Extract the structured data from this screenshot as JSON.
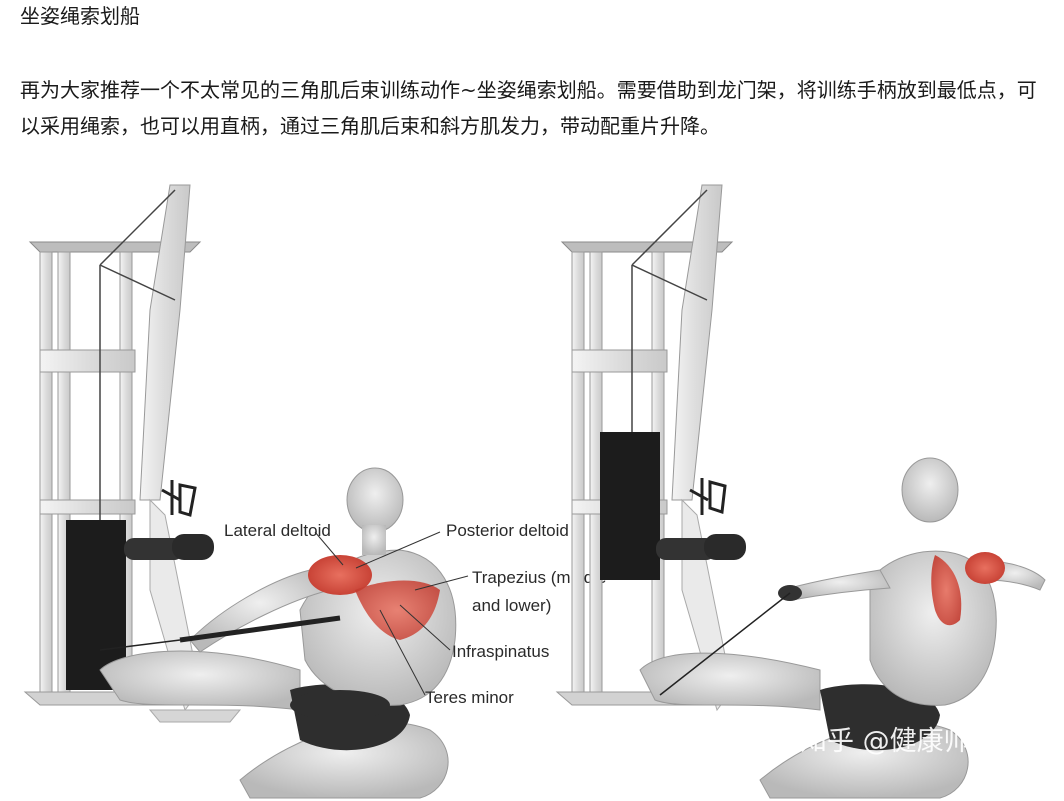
{
  "article": {
    "heading": "坐姿绳索划船",
    "paragraph": "再为大家推荐一个不太常见的三角肌后束训练动作~坐姿绳索划船。需要借助到龙门架，将训练手柄放到最低点，可以采用绳索，也可以用直柄，通过三角肌后束和斜方肌发力，带动配重片升降。"
  },
  "figure": {
    "labels": {
      "lateral_deltoid": "Lateral deltoid",
      "posterior_deltoid": "Posterior deltoid",
      "trapezius_1": "Trapezius (middle",
      "trapezius_2": "and lower)",
      "infraspinatus": "Infraspinatus",
      "teres_minor": "Teres minor"
    },
    "watermark": "知乎 @健康帅帅",
    "colors": {
      "machine_frame": "#e6e6e6",
      "weight_stack": "#1c1c1c",
      "muscle_highlight": "#d9534f",
      "skin": "#d8d8d8",
      "shorts": "#2e2e2e"
    }
  }
}
